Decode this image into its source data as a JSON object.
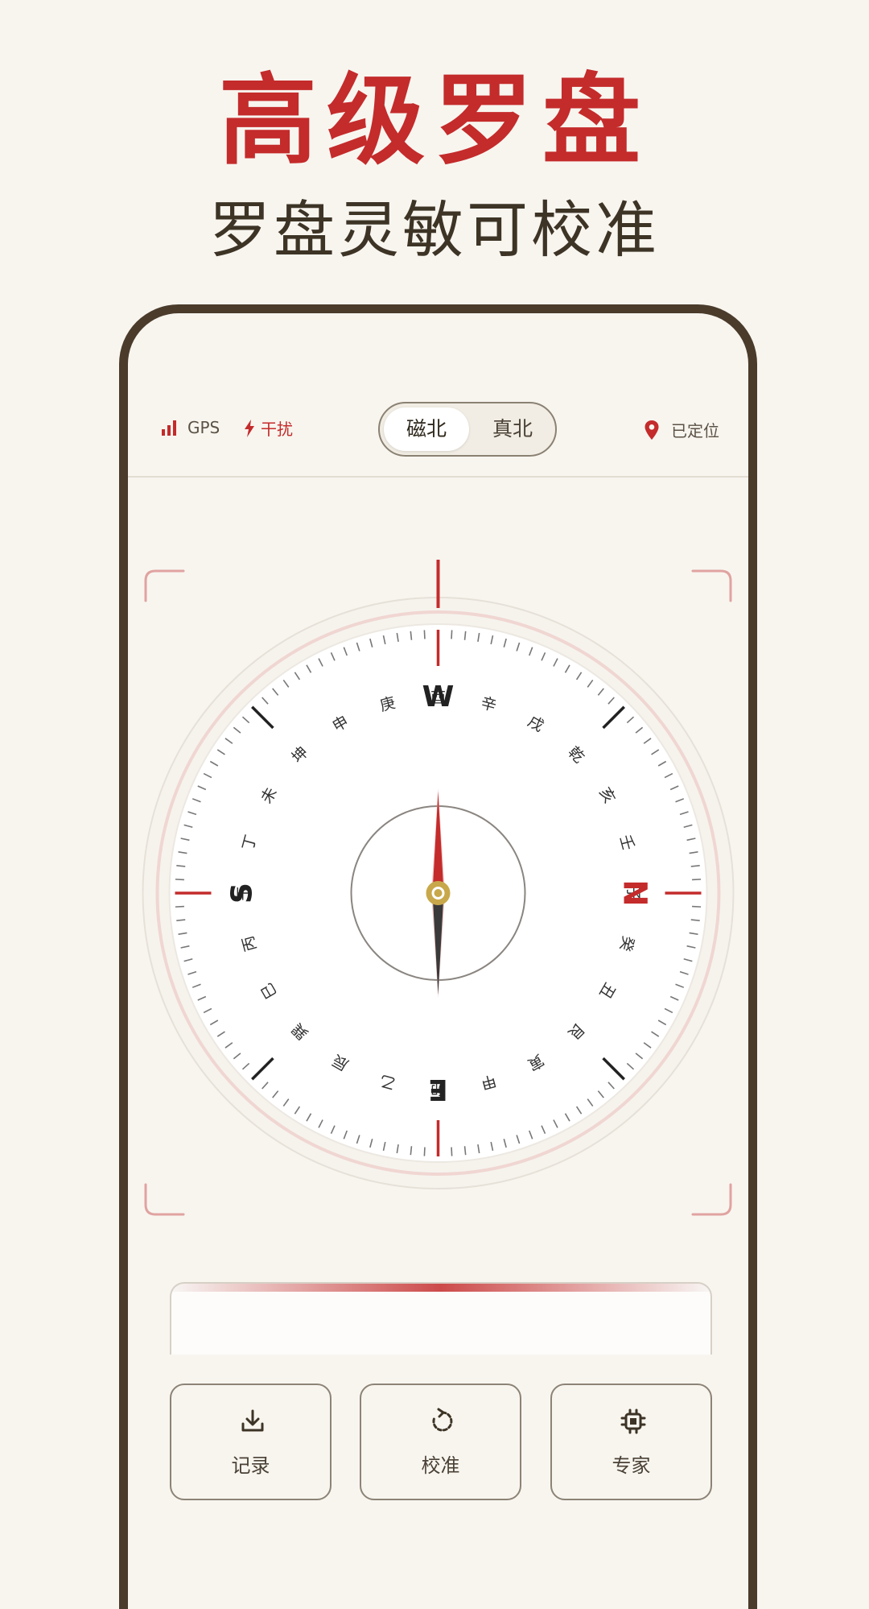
{
  "promo": {
    "title": "高级罗盘",
    "subtitle": "罗盘灵敏可校准"
  },
  "status": {
    "gps_label": "GPS",
    "interference_label": "干扰",
    "location_label": "已定位"
  },
  "north_toggle": {
    "options": [
      "磁北",
      "真北"
    ],
    "selected": "磁北"
  },
  "compass": {
    "cardinals": {
      "N": "N",
      "E": "E",
      "S": "S",
      "W": "W"
    },
    "mountains": [
      "子",
      "癸",
      "丑",
      "艮",
      "寅",
      "甲",
      "卯",
      "乙",
      "辰",
      "巽",
      "巳",
      "丙",
      "午",
      "丁",
      "未",
      "坤",
      "申",
      "庚",
      "酉",
      "辛",
      "戌",
      "乾",
      "亥",
      "壬"
    ],
    "heading_deg": 270
  },
  "actions": [
    {
      "label": "记录",
      "icon": "download-icon"
    },
    {
      "label": "校准",
      "icon": "rotate-icon"
    },
    {
      "label": "专家",
      "icon": "chip-icon"
    }
  ],
  "colors": {
    "accent": "#c42b2b",
    "frame": "#4a3b2b",
    "background": "#f8f5ef",
    "pivot": "#c8a84a"
  }
}
